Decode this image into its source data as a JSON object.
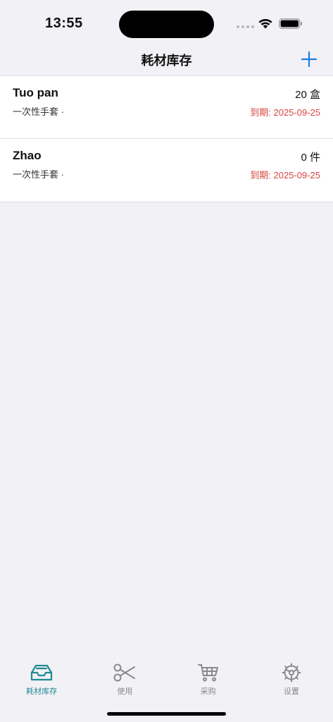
{
  "status_bar": {
    "time": "13:55"
  },
  "nav": {
    "title": "耗材库存",
    "add_icon": "plus-icon",
    "accent_color": "#1a7fe0"
  },
  "items": [
    {
      "name": "Tuo pan",
      "category": "一次性手套 ·",
      "quantity": "20 盒",
      "expiry": "到期: 2025-09-25"
    },
    {
      "name": "Zhao",
      "category": "一次性手套 ·",
      "quantity": "0 件",
      "expiry": "到期: 2025-09-25"
    }
  ],
  "colors": {
    "expiry": "#d64540",
    "active_tab": "#1f8a93",
    "inactive_tab": "#8a8a8e"
  },
  "tabs": [
    {
      "label": "耗材库存",
      "icon": "inbox-tray-icon",
      "active": true
    },
    {
      "label": "使用",
      "icon": "scissors-icon",
      "active": false
    },
    {
      "label": "采购",
      "icon": "cart-icon",
      "active": false
    },
    {
      "label": "设置",
      "icon": "gear-icon",
      "active": false
    }
  ]
}
